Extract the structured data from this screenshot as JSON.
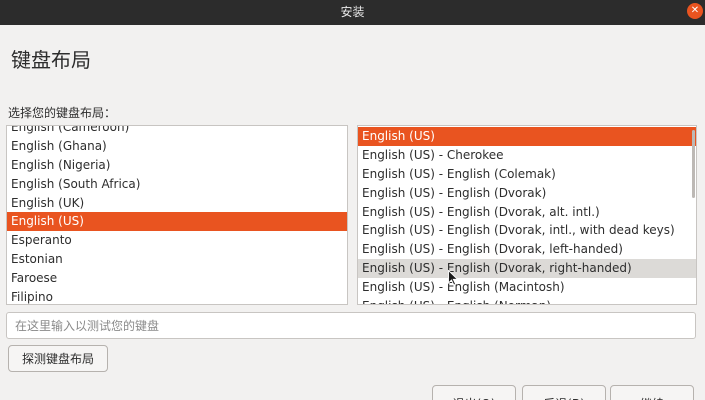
{
  "window": {
    "title": "安装",
    "close_glyph": "✕"
  },
  "page": {
    "heading": "键盘布局",
    "prompt": "选择您的键盘布局："
  },
  "layouts_left": {
    "items": [
      {
        "label": "English (Cameroon)",
        "selected": false
      },
      {
        "label": "English (Ghana)",
        "selected": false
      },
      {
        "label": "English (Nigeria)",
        "selected": false
      },
      {
        "label": "English (South Africa)",
        "selected": false
      },
      {
        "label": "English (UK)",
        "selected": false
      },
      {
        "label": "English (US)",
        "selected": true
      },
      {
        "label": "Esperanto",
        "selected": false
      },
      {
        "label": "Estonian",
        "selected": false
      },
      {
        "label": "Faroese",
        "selected": false
      },
      {
        "label": "Filipino",
        "selected": false
      }
    ]
  },
  "layouts_right": {
    "items": [
      {
        "label": "English (US)",
        "selected": true
      },
      {
        "label": "English (US) - Cherokee",
        "selected": false
      },
      {
        "label": "English (US) - English (Colemak)",
        "selected": false
      },
      {
        "label": "English (US) - English (Dvorak)",
        "selected": false
      },
      {
        "label": "English (US) - English (Dvorak, alt. intl.)",
        "selected": false
      },
      {
        "label": "English (US) - English (Dvorak, intl., with dead keys)",
        "selected": false
      },
      {
        "label": "English (US) - English (Dvorak, left-handed)",
        "selected": false
      },
      {
        "label": "English (US) - English (Dvorak, right-handed)",
        "selected": false,
        "hover": true
      },
      {
        "label": "English (US) - English (Macintosh)",
        "selected": false
      },
      {
        "label": "English (US) - English (Norman)",
        "selected": false
      }
    ]
  },
  "test_input": {
    "placeholder": "在这里输入以测试您的键盘",
    "value": ""
  },
  "buttons": {
    "detect": "探测键盘布局",
    "quit": "退出(Q)",
    "back": "后退(B)",
    "continue": "继续"
  },
  "colors": {
    "accent": "#e95420",
    "titlebar": "#2c2c2c",
    "background": "#f2f1f0"
  }
}
